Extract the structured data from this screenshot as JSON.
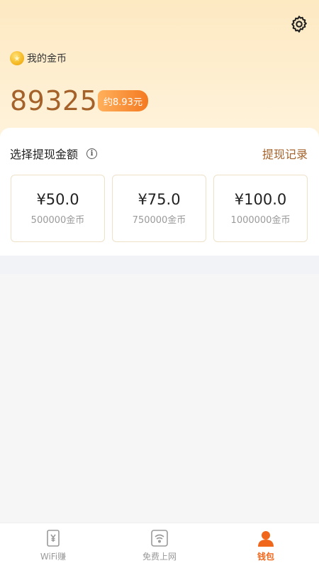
{
  "header": {
    "coin_label": "我的金币",
    "balance": "89325",
    "approx_value": "约8.93元"
  },
  "withdraw": {
    "title": "选择提现金额",
    "record_link": "提现记录",
    "options": [
      {
        "amount": "¥50.0",
        "coins": "500000金币"
      },
      {
        "amount": "¥75.0",
        "coins": "750000金币"
      },
      {
        "amount": "¥100.0",
        "coins": "1000000金币"
      }
    ]
  },
  "tabbar": {
    "tabs": [
      {
        "label": "WiFi赚",
        "icon": "wallet-yen-icon",
        "active": false
      },
      {
        "label": "免费上网",
        "icon": "wifi-icon",
        "active": false
      },
      {
        "label": "钱包",
        "icon": "person-icon",
        "active": true
      }
    ]
  },
  "colors": {
    "accent_brown": "#a4622a",
    "accent_orange": "#f0671b",
    "header_bg": "#fde9c2"
  }
}
